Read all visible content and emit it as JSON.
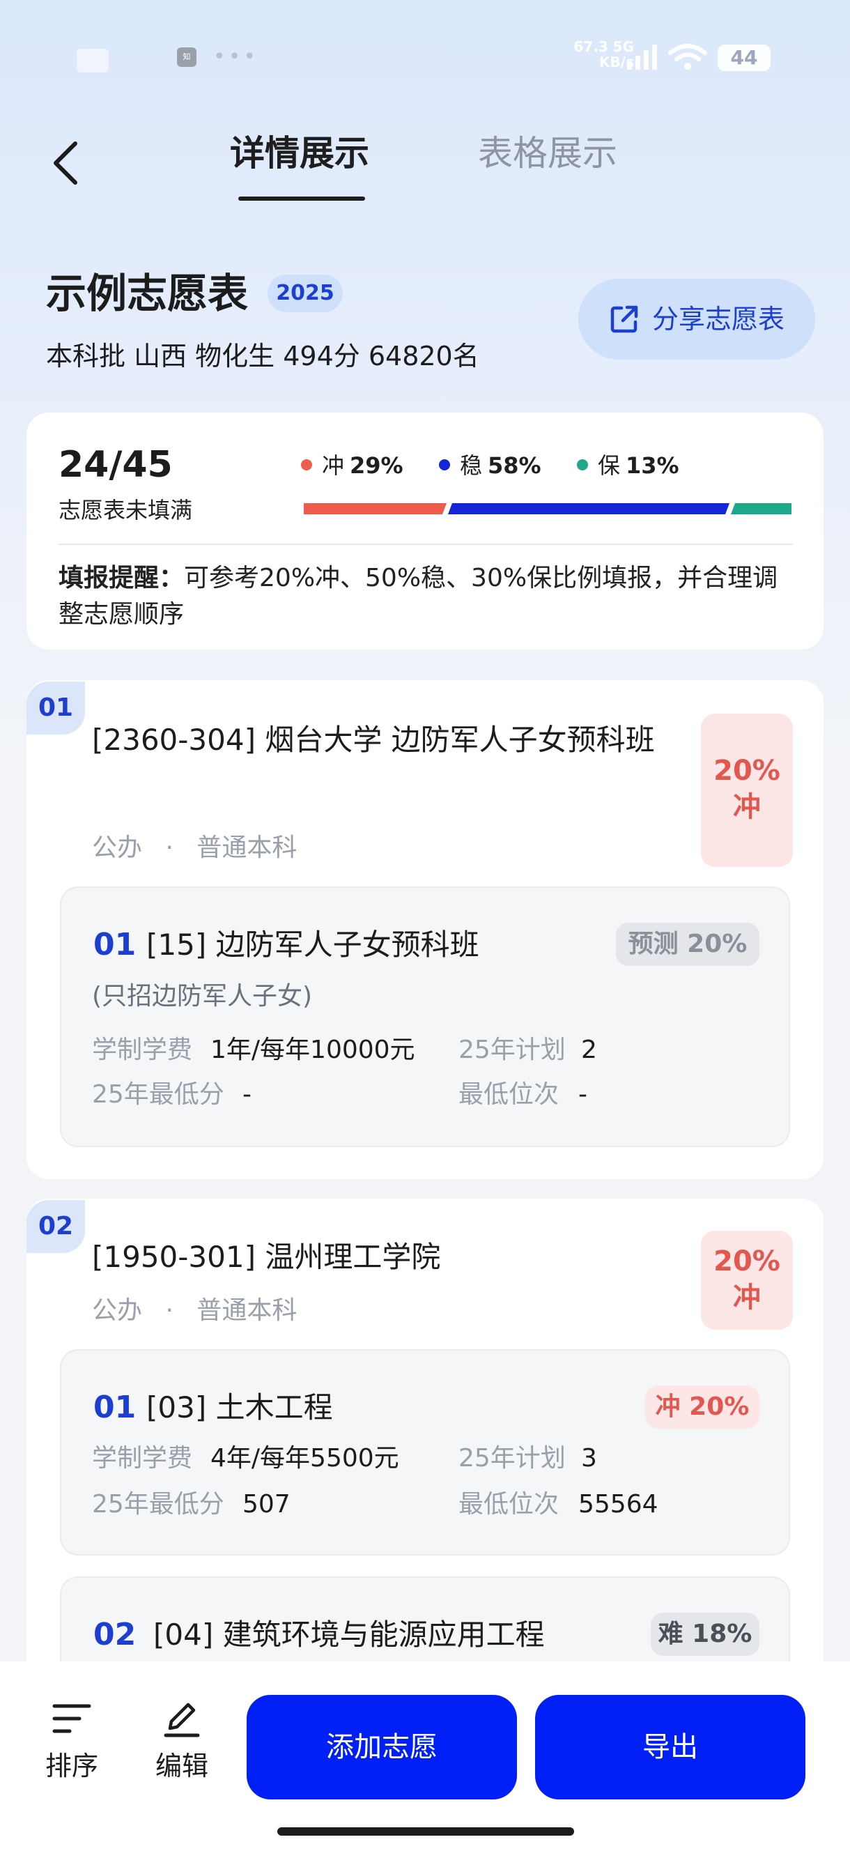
{
  "status_bar": {
    "app_icon_text": "知",
    "dots": "•••",
    "net_speed_top": "67.3 5G",
    "net_speed_bottom": "KB/s",
    "battery": "44"
  },
  "header": {
    "tabs": [
      {
        "label": "详情展示",
        "active": true
      },
      {
        "label": "表格展示",
        "active": false
      }
    ]
  },
  "summary": {
    "title": "示例志愿表",
    "year": "2025",
    "subtitle": "本科批 山西 物化生 494分 64820名",
    "share_label": "分享志愿表",
    "count": "24/45",
    "count_note": "志愿表未填满",
    "legend": [
      {
        "name": "冲",
        "pct": "29%",
        "color": "#ef5b4c",
        "value": 29
      },
      {
        "name": "稳",
        "pct": "58%",
        "color": "#1426d8",
        "value": 58
      },
      {
        "name": "保",
        "pct": "13%",
        "color": "#1ea88a",
        "value": 13
      }
    ],
    "tip_label": "填报提醒：",
    "tip_text": "可参考20%冲、50%稳、30%保比例填报，并合理调整志愿顺序"
  },
  "schools": [
    {
      "index": "01",
      "name": "[2360-304] 烟台大学 边防军人子女预科班",
      "meta_a": "公办",
      "meta_sep": "·",
      "meta_b": "普通本科",
      "prob_pct": "20%",
      "prob_label": "冲",
      "majors": [
        {
          "index": "01",
          "name": "[15] 边防军人子女预科班",
          "tag": "预测 20%",
          "note": "(只招边防军人子女)",
          "fee_label": "学制学费",
          "fee": "1年/每年10000元",
          "plan_label": "25年计划",
          "plan": "2",
          "min_score_label": "25年最低分",
          "min_score": "-",
          "min_rank_label": "最低位次",
          "min_rank": "-"
        }
      ]
    },
    {
      "index": "02",
      "name": "[1950-301] 温州理工学院",
      "meta_a": "公办",
      "meta_sep": "·",
      "meta_b": "普通本科",
      "prob_pct": "20%",
      "prob_label": "冲",
      "majors": [
        {
          "index": "01",
          "name": "[03] 土木工程",
          "tag": "冲 20%",
          "fee_label": "学制学费",
          "fee": "4年/每年5500元",
          "plan_label": "25年计划",
          "plan": "3",
          "min_score_label": "25年最低分",
          "min_score": "507",
          "min_rank_label": "最低位次",
          "min_rank": "55564"
        },
        {
          "index": "02",
          "name": "[04] 建筑环境与能源应用工程",
          "tag": "难 18%"
        }
      ]
    }
  ],
  "bottom_bar": {
    "sort_label": "排序",
    "edit_label": "编辑",
    "add_label": "添加志愿",
    "export_label": "导出"
  },
  "colors": {
    "accent": "#1d3fcf",
    "primary_button": "#0020f5",
    "rush_red": "#e2584f"
  }
}
